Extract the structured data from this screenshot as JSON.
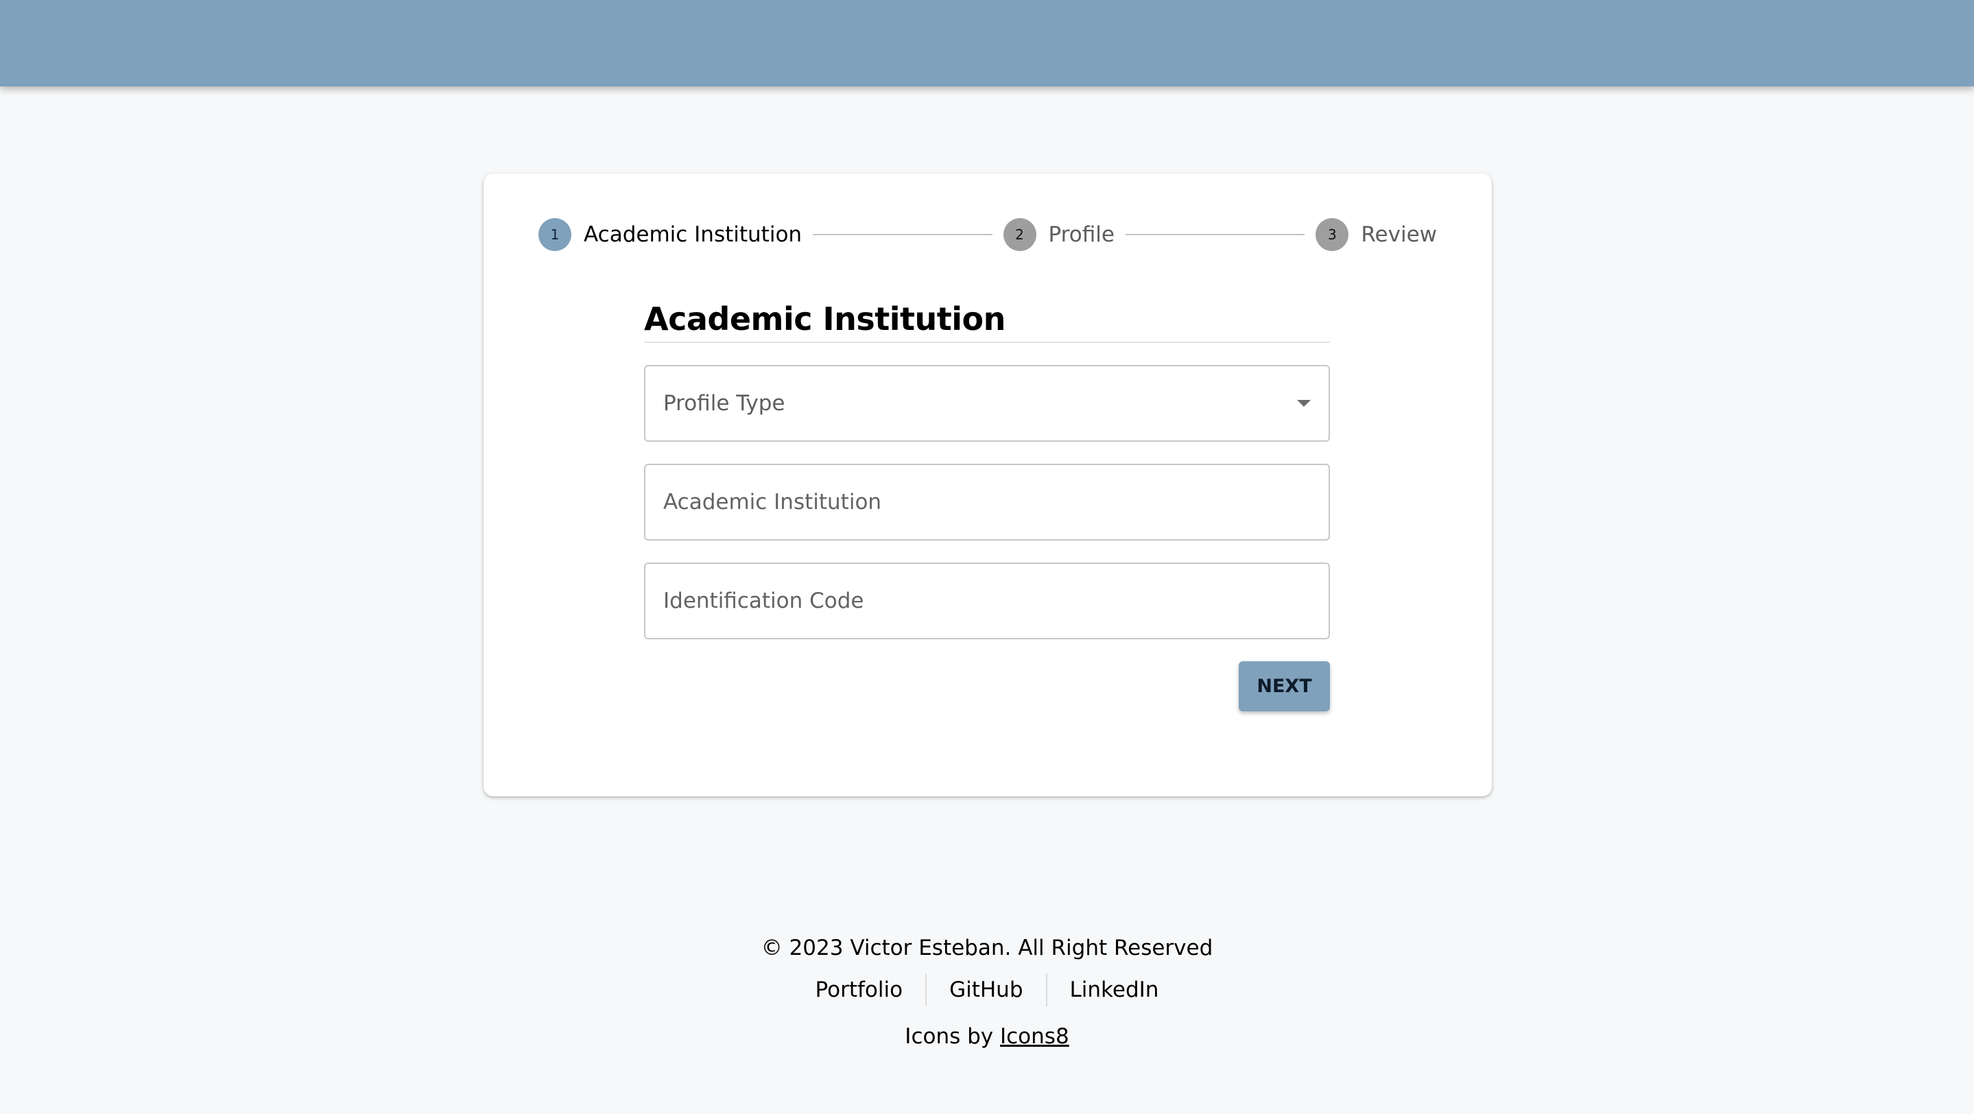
{
  "stepper": {
    "steps": [
      {
        "number": "1",
        "label": "Academic Institution",
        "state": "active"
      },
      {
        "number": "2",
        "label": "Profile",
        "state": "inactive"
      },
      {
        "number": "3",
        "label": "Review",
        "state": "inactive"
      }
    ]
  },
  "form": {
    "title": "Academic Institution",
    "profile_type": {
      "placeholder": "Profile Type",
      "value": ""
    },
    "academic_institution": {
      "placeholder": "Academic Institution",
      "value": ""
    },
    "identification_code": {
      "placeholder": "Identification Code",
      "value": ""
    },
    "next_label": "NEXT"
  },
  "footer": {
    "copyright": "© 2023 Victor Esteban. All Right Reserved",
    "links": [
      "Portfolio",
      "GitHub",
      "LinkedIn"
    ],
    "credits_prefix": "Icons by",
    "credits_link": "Icons8"
  },
  "colors": {
    "primary": "#80a1bb",
    "background": "#f7f8f9",
    "inactive_step": "#9e9e9e"
  },
  "icons": {
    "select_caret": "caret-down-icon"
  }
}
